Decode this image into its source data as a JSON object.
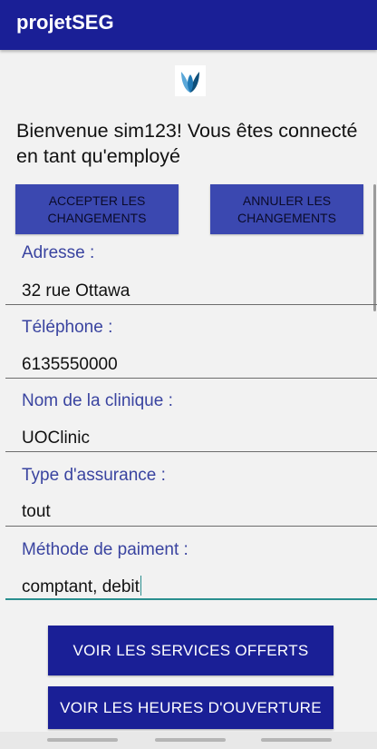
{
  "app": {
    "title": "projetSEG"
  },
  "logo": {
    "icon": "clinic-logo-icon"
  },
  "welcome": {
    "text": "Bienvenue sim123! Vous êtes connecté en tant qu'employé"
  },
  "actions": {
    "accept_label": "ACCEPTER LES CHANGEMENTS",
    "cancel_label": "ANNULER LES CHANGEMENTS"
  },
  "fields": [
    {
      "label": "Adresse :",
      "value": "32 rue Ottawa"
    },
    {
      "label": "Téléphone :",
      "value": "6135550000"
    },
    {
      "label": "Nom de la clinique :",
      "value": "UOClinic"
    },
    {
      "label": "Type d'assurance :",
      "value": "tout"
    },
    {
      "label": "Méthode de paiment :",
      "value": "comptant, debit"
    }
  ],
  "nav": {
    "services_label": "VOIR LES SERVICES OFFERTS",
    "hours_label": "VOIR LES HEURES D'OUVERTURE"
  },
  "colors": {
    "primary": "#1a1f96",
    "button_secondary": "#3b48b0",
    "label": "#3a44a0",
    "focus": "#2a8f8f"
  }
}
